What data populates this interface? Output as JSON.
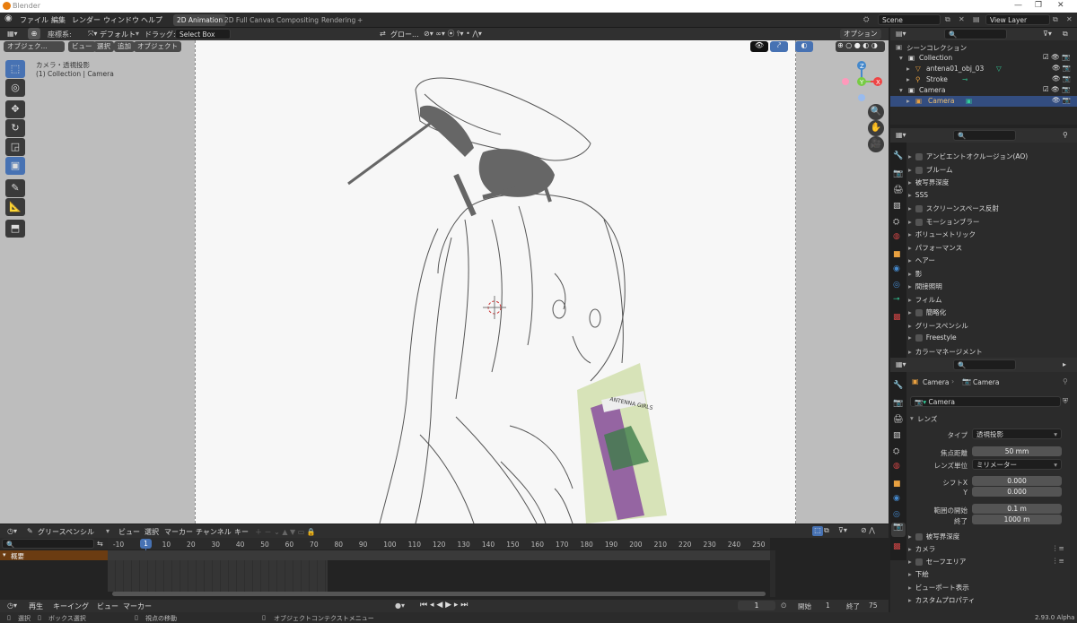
{
  "window": {
    "title": "Blender"
  },
  "menubar": {
    "menus": [
      "ファイル",
      "編集",
      "レンダー",
      "ウィンドウ",
      "ヘルプ"
    ],
    "workspace_tabs": [
      "2D Animation",
      "2D Full Canvas",
      "Compositing",
      "Rendering"
    ],
    "add_tab": "+",
    "scene": "Scene",
    "view_layer": "View Layer"
  },
  "toolheader": {
    "orientation_label": "座標系:",
    "orientation_value": "デフォルト",
    "drag_label": "ドラッグ:",
    "drag_value": "Select Box",
    "pivot_value": "グロー...",
    "options_label": "オプション"
  },
  "viewport_header": {
    "mode": "オブジェク...",
    "menus": [
      "ビュー",
      "選択",
      "追加",
      "オブジェクト"
    ]
  },
  "viewport": {
    "overlay_line1": "カメラ・透視投影",
    "overlay_line2": "(1) Collection | Camera",
    "cover_text": "ANTENNA GIRLS",
    "gizmo_axes": {
      "x": "X",
      "y": "Y",
      "z": "Z"
    }
  },
  "outliner": {
    "header": "シーンコレクション",
    "items": [
      {
        "label": "Collection",
        "level": 0
      },
      {
        "label": "antena01_obj_03",
        "level": 1
      },
      {
        "label": "Stroke",
        "level": 1
      },
      {
        "label": "Camera",
        "level": 0
      },
      {
        "label": "Camera",
        "level": 1
      }
    ]
  },
  "render_props": {
    "sections": [
      {
        "label": "アンビエントオクルージョン(AO)",
        "checkbox": true
      },
      {
        "label": "ブルーム",
        "checkbox": true
      },
      {
        "label": "被写界深度",
        "checkbox": false
      },
      {
        "label": "SSS",
        "checkbox": false
      },
      {
        "label": "スクリーンスペース反射",
        "checkbox": true
      },
      {
        "label": "モーションブラー",
        "checkbox": true
      },
      {
        "label": "ボリューメトリック",
        "checkbox": false
      },
      {
        "label": "パフォーマンス",
        "checkbox": false
      },
      {
        "label": "ヘアー",
        "checkbox": false
      },
      {
        "label": "影",
        "checkbox": false
      },
      {
        "label": "間接照明",
        "checkbox": false
      },
      {
        "label": "フィルム",
        "checkbox": false
      },
      {
        "label": "簡略化",
        "checkbox": true
      },
      {
        "label": "グリースペンシル",
        "checkbox": false
      },
      {
        "label": "Freestyle",
        "checkbox": true
      },
      {
        "label": "カラーマネージメント",
        "checkbox": false
      }
    ]
  },
  "camera_props": {
    "breadcrumb_object": "Camera",
    "breadcrumb_data": "Camera",
    "data_name": "Camera",
    "lens_section": "レンズ",
    "type_label": "タイプ",
    "type_value": "透視投影",
    "focal_label": "焦点距離",
    "focal_value": "50 mm",
    "lens_unit_label": "レンズ単位",
    "lens_unit_value": "ミリメーター",
    "shift_x_label": "シフトX",
    "shift_x_value": "0.000",
    "shift_y_label": "Y",
    "shift_y_value": "0.000",
    "clip_start_label": "範囲の開始",
    "clip_start_value": "0.1 m",
    "clip_end_label": "終了",
    "clip_end_value": "1000 m",
    "sections": [
      "被写界深度",
      "カメラ",
      "セーフエリア",
      "下絵",
      "ビューポート表示",
      "カスタムプロパティ"
    ]
  },
  "timeline": {
    "mode": "グリースペンシル",
    "menus": [
      "ビュー",
      "選択",
      "マーカー",
      "チャンネル",
      "キー"
    ],
    "summary_label": "概要",
    "current_frame": "1",
    "ticks": [
      "-10",
      "10",
      "20",
      "30",
      "40",
      "50",
      "60",
      "70",
      "80",
      "90",
      "100",
      "110",
      "120",
      "130",
      "140",
      "150",
      "160",
      "170",
      "180",
      "190",
      "200",
      "210",
      "220",
      "230",
      "240",
      "250"
    ]
  },
  "playback": {
    "menus": [
      "再生",
      "キーイング",
      "ビュー",
      "マーカー"
    ],
    "frame": "1",
    "start_label": "開始",
    "start_value": "1",
    "end_label": "終了",
    "end_value": "75"
  },
  "statusbar": {
    "select": "選択",
    "box_select": "ボックス選択",
    "move_view": "視点の移動",
    "context_menu": "オブジェクトコンテクストメニュー",
    "version": "2.93.0 Alpha"
  }
}
